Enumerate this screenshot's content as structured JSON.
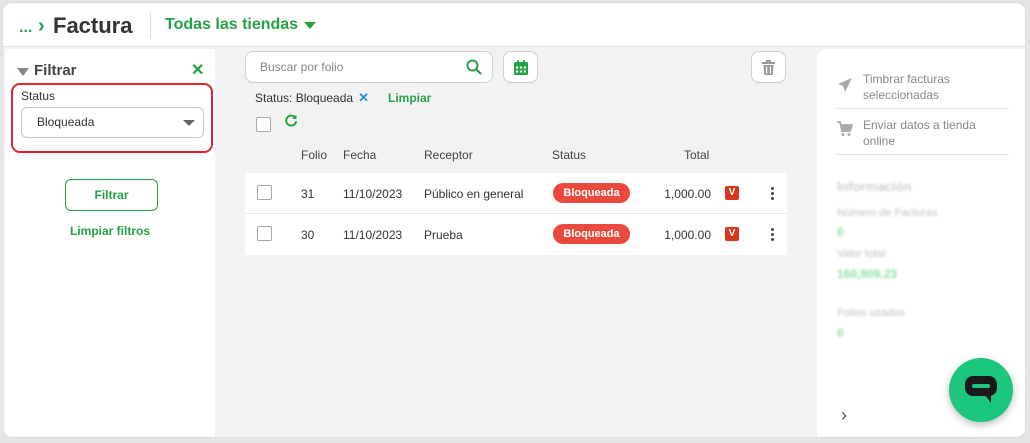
{
  "header": {
    "breadcrumb_dots": "...",
    "title": "Factura",
    "store_selector": "Todas las tiendas"
  },
  "filter": {
    "title": "Filtrar",
    "status_label": "Status",
    "status_value": "Bloqueada",
    "apply_label": "Filtrar",
    "clear_label": "Limpiar filtros"
  },
  "search": {
    "placeholder": "Buscar por folio"
  },
  "active_filter": {
    "text": "Status: Bloqueada",
    "clear_label": "Limpiar"
  },
  "table": {
    "columns": [
      "Folio",
      "Fecha",
      "Receptor",
      "Status",
      "Total"
    ],
    "rows": [
      {
        "folio": "31",
        "fecha": "11/10/2023",
        "receptor": "Público en general",
        "status": "Bloqueada",
        "total": "1,000.00",
        "flag": "V"
      },
      {
        "folio": "30",
        "fecha": "11/10/2023",
        "receptor": "Prueba",
        "status": "Bloqueada",
        "total": "1,000.00",
        "flag": "V"
      }
    ]
  },
  "side_panel": {
    "actions": [
      {
        "label": "Timbrar facturas seleccionadas",
        "icon": "send-icon"
      },
      {
        "label": "Enviar datos a tienda online",
        "icon": "cart-icon"
      }
    ],
    "info_title": "Información",
    "info_items": [
      {
        "label": "Número de Facturas",
        "value": "0"
      },
      {
        "label": "Valor total",
        "value": "160,909.23"
      },
      {
        "label": "Folios usados",
        "value": "0"
      }
    ]
  },
  "colors": {
    "accent": "#27a047",
    "badge_red": "#ea4a3e",
    "flag_red": "#d8361c",
    "highlight_red": "#e0252e",
    "fab_green": "#1dc67d"
  }
}
